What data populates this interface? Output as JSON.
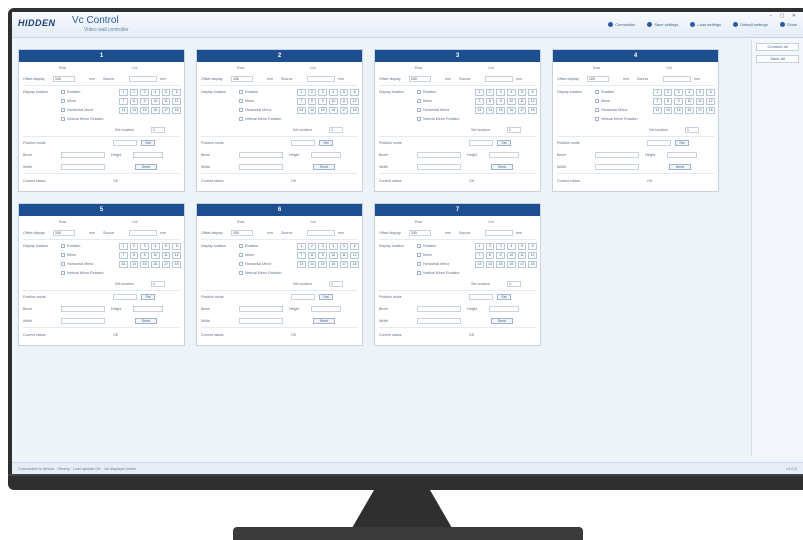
{
  "app": {
    "logo": "HIDDEN",
    "title": "Vc Control",
    "subtitle": "Video wall controller",
    "window_controls": "– ▢ ✕"
  },
  "toolbar": {
    "items": [
      "Connection",
      "Save settings",
      "Load settings",
      "Default settings",
      "Close"
    ]
  },
  "sidebar": {
    "items": [
      "Connect all",
      "Save all"
    ]
  },
  "panel_template": {
    "col_left": "Row",
    "col_right": "Col",
    "offset_label": "Offset display",
    "offset_value": "100",
    "offset_unit": "mm",
    "source_label": "Source",
    "location_label": "Display location",
    "options": [
      "Rotation",
      "Mirror",
      "Horizontal Mirror",
      "Vertical Mirror Rotation"
    ],
    "grid_cells": [
      "1",
      "2",
      "3",
      "4",
      "5",
      "6",
      "7",
      "8",
      "9",
      "10",
      "11",
      "12",
      "13",
      "14",
      "15",
      "16",
      "17",
      "18"
    ],
    "apply_label": "Set location",
    "apply_value": "1",
    "position_label": "Position mode",
    "position_btn": "Set",
    "bezel_label": "Bezel",
    "width_label": "Width",
    "height_label": "Height",
    "send_btn": "Send",
    "status_label": "Current status",
    "status_value": "OK"
  },
  "panels": [
    {
      "title": "1"
    },
    {
      "title": "2"
    },
    {
      "title": "3"
    },
    {
      "title": "4"
    },
    {
      "title": "5"
    },
    {
      "title": "6"
    },
    {
      "title": "7"
    }
  ],
  "statusbar": {
    "left": "Connected to device · Ready · Last update OK · All displays online",
    "right": "v1.0.0"
  },
  "colors": {
    "header": "#1d4e8f",
    "accent": "#2c5aa0",
    "bezel": "#2f2f2f"
  }
}
